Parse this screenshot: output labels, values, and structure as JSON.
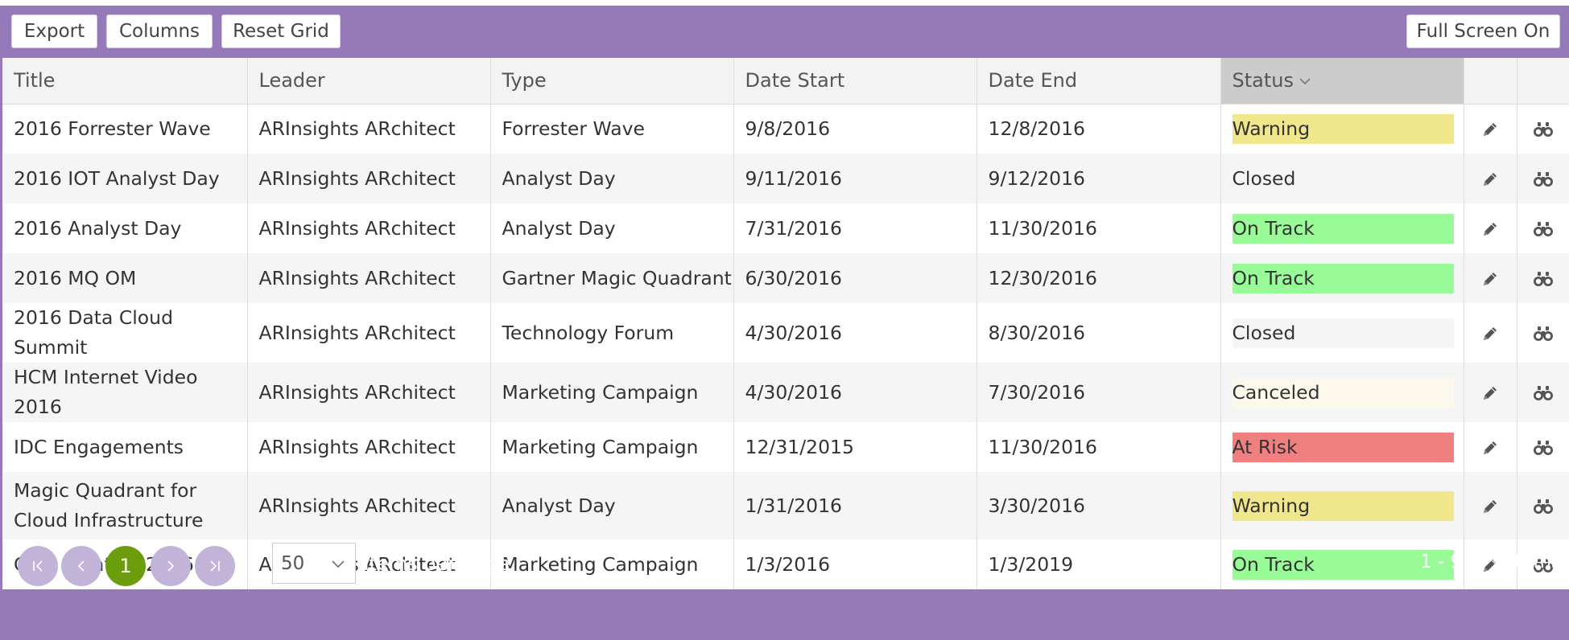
{
  "toolbar": {
    "export_label": "Export",
    "columns_label": "Columns",
    "reset_label": "Reset Grid",
    "fullscreen_label": "Full Screen On"
  },
  "columns": [
    "Title",
    "Leader",
    "Type",
    "Date Start",
    "Date End",
    "Status"
  ],
  "rows": [
    {
      "title": "2016 Forrester Wave",
      "leader": "ARInsights ARchitect",
      "type": "Forrester Wave",
      "start": "9/8/2016",
      "end": "12/8/2016",
      "status": "Warning",
      "status_color": "#f0e68c"
    },
    {
      "title": "2016 IOT Analyst Day",
      "leader": "ARInsights ARchitect",
      "type": "Analyst Day",
      "start": "9/11/2016",
      "end": "9/12/2016",
      "status": "Closed",
      "status_color": ""
    },
    {
      "title": "2016 Analyst Day",
      "leader": "ARInsights ARchitect",
      "type": "Analyst Day",
      "start": "7/31/2016",
      "end": "11/30/2016",
      "status": "On Track",
      "status_color": "#98fb98"
    },
    {
      "title": "2016 MQ OM",
      "leader": "ARInsights ARchitect",
      "type": "Gartner Magic Quadrant",
      "start": "6/30/2016",
      "end": "12/30/2016",
      "status": "On Track",
      "status_color": "#98fb98"
    },
    {
      "title": "2016 Data Cloud Summit",
      "leader": "ARInsights ARchitect",
      "type": "Technology Forum",
      "start": "4/30/2016",
      "end": "8/30/2016",
      "status": "Closed",
      "status_color": "#f5f5f5"
    },
    {
      "title": "HCM Internet Video 2016",
      "leader": "ARInsights ARchitect",
      "type": "Marketing Campaign",
      "start": "4/30/2016",
      "end": "7/30/2016",
      "status": "Canceled",
      "status_color": "#fdf8ec"
    },
    {
      "title": "IDC Engagements",
      "leader": "ARInsights ARchitect",
      "type": "Marketing Campaign",
      "start": "12/31/2015",
      "end": "11/30/2016",
      "status": "At Risk",
      "status_color": "#f08080"
    },
    {
      "title": "Magic Quadrant for Cloud Infrastructure",
      "leader": "ARInsights ARchitect",
      "type": "Analyst Day",
      "start": "1/31/2016",
      "end": "3/30/2016",
      "status": "Warning",
      "status_color": "#f0e68c"
    },
    {
      "title": "CRM Initative 2016",
      "leader": "ARInsights ARchitect",
      "type": "Marketing Campaign",
      "start": "1/3/2016",
      "end": "1/3/2019",
      "status": "On Track",
      "status_color": "#98fb98"
    }
  ],
  "icons": [
    "pencil-icon",
    "binoculars-icon",
    "chevron-down-icon",
    "first-page-icon",
    "previous-page-icon",
    "next-page-icon",
    "last-page-icon"
  ],
  "pager": {
    "current_page": "1",
    "page_size": "50",
    "items_label": "items per page",
    "info": "1 - 9 of 9 items"
  },
  "colors": {
    "accent": "#9579b9",
    "active_page": "#6c9d0c",
    "pager_button": "#c2b3d8"
  }
}
